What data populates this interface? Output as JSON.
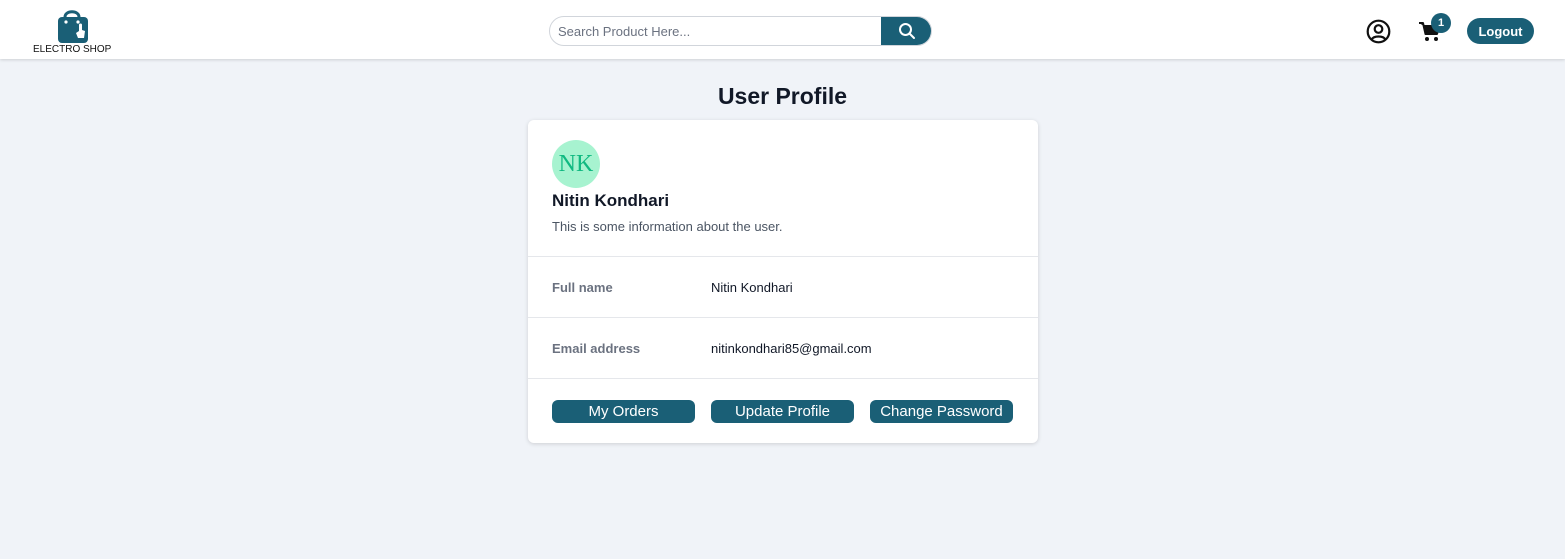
{
  "header": {
    "logo_text": "ELECTRO SHOP",
    "search_placeholder": "Search Product Here...",
    "search_value": "",
    "cart_count": "1",
    "logout_label": "Logout",
    "icons": {
      "logo": "shopping-bag-icon",
      "search": "search-icon",
      "user": "user-circle-icon",
      "cart": "cart-icon"
    }
  },
  "page": {
    "title": "User Profile"
  },
  "profile": {
    "initials": "NK",
    "name": "Nitin Kondhari",
    "info": "This is some information about the user.",
    "fields": [
      {
        "label": "Full name",
        "value": "Nitin Kondhari"
      },
      {
        "label": "Email address",
        "value": "nitinkondhari85@gmail.com"
      }
    ],
    "actions": [
      "My Orders",
      "Update Profile",
      "Change Password"
    ]
  },
  "colors": {
    "primary": "#1a5f76",
    "background": "#f0f3f8",
    "avatar_bg": "#a7f3d0",
    "avatar_text": "#10b981"
  }
}
